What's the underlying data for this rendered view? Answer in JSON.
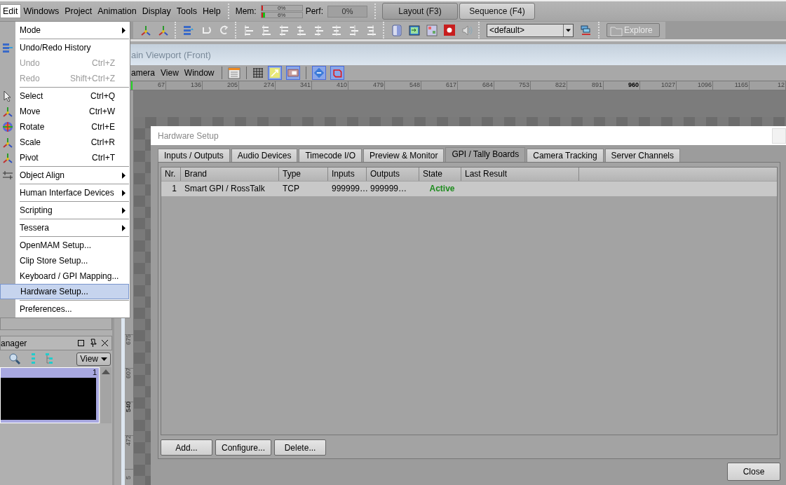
{
  "menubar": {
    "menus": [
      {
        "label": "Edit",
        "selected": true
      },
      {
        "label": "Windows",
        "selected": false
      },
      {
        "label": "Project",
        "selected": false
      },
      {
        "label": "Animation",
        "selected": false
      },
      {
        "label": "Display",
        "selected": false
      },
      {
        "label": "Tools",
        "selected": false
      },
      {
        "label": "Help",
        "selected": false
      }
    ]
  },
  "monitor": {
    "mem_label": "Mem:",
    "mem_meters": [
      {
        "reading": "0%",
        "level": 0
      },
      {
        "reading": "6%",
        "level": 0.06
      }
    ],
    "perf_label": "Perf:",
    "perf_reading": "0%"
  },
  "mode_buttons": [
    {
      "label": "Layout (F3)",
      "selected": true
    },
    {
      "label": "Sequence (F4)",
      "selected": false
    }
  ],
  "toolbar": {
    "preset_dropdown": {
      "value": "<default>"
    },
    "explore_button": {
      "label": "Explore",
      "disabled": true
    }
  },
  "viewport": {
    "title": "ain Viewport (Front)",
    "menus": [
      "amera",
      "View",
      "Window"
    ],
    "ruler_top": [
      {
        "label": "67",
        "selected": false
      },
      {
        "label": "136",
        "selected": false
      },
      {
        "label": "205",
        "selected": false
      },
      {
        "label": "274",
        "selected": false
      },
      {
        "label": "341",
        "selected": false
      },
      {
        "label": "410",
        "selected": false
      },
      {
        "label": "479",
        "selected": false
      },
      {
        "label": "548",
        "selected": false
      },
      {
        "label": "617",
        "selected": false
      },
      {
        "label": "684",
        "selected": false
      },
      {
        "label": "753",
        "selected": false
      },
      {
        "label": "822",
        "selected": false
      },
      {
        "label": "891",
        "selected": false
      },
      {
        "label": "960",
        "selected": true
      },
      {
        "label": "1027",
        "selected": false
      },
      {
        "label": "1096",
        "selected": false
      },
      {
        "label": "1165",
        "selected": false
      },
      {
        "label": "12",
        "selected": false
      }
    ],
    "ruler_left": [
      {
        "label": "675",
        "selected": false
      },
      {
        "label": "607",
        "selected": false
      },
      {
        "label": "540",
        "selected": true
      },
      {
        "label": "472",
        "selected": false
      },
      {
        "label": "5",
        "selected": false
      }
    ]
  },
  "left_panel": {
    "title": "anager",
    "view_button": "View",
    "list_header": "1"
  },
  "edit_menu": {
    "groups": [
      [
        {
          "label": "Mode",
          "submenu": true,
          "disabled": false,
          "selected": false
        }
      ],
      [
        {
          "label": "Undo/Redo History",
          "submenu": false,
          "disabled": false,
          "selected": false
        },
        {
          "label": "Undo",
          "shortcut": "Ctrl+Z",
          "submenu": false,
          "disabled": true,
          "selected": false
        },
        {
          "label": "Redo",
          "shortcut": "Shift+Ctrl+Z",
          "submenu": false,
          "disabled": true,
          "selected": false
        }
      ],
      [
        {
          "label": "Select",
          "shortcut": "Ctrl+Q",
          "submenu": false,
          "disabled": false,
          "selected": false
        },
        {
          "label": "Move",
          "shortcut": "Ctrl+W",
          "submenu": false,
          "disabled": false,
          "selected": false
        },
        {
          "label": "Rotate",
          "shortcut": "Ctrl+E",
          "submenu": false,
          "disabled": false,
          "selected": false
        },
        {
          "label": "Scale",
          "shortcut": "Ctrl+R",
          "submenu": false,
          "disabled": false,
          "selected": false
        },
        {
          "label": "Pivot",
          "shortcut": "Ctrl+T",
          "submenu": false,
          "disabled": false,
          "selected": false
        }
      ],
      [
        {
          "label": "Object Align",
          "submenu": true,
          "disabled": false,
          "selected": false
        }
      ],
      [
        {
          "label": "Human Interface Devices",
          "submenu": true,
          "disabled": false,
          "selected": false
        }
      ],
      [
        {
          "label": "Scripting",
          "submenu": true,
          "disabled": false,
          "selected": false
        }
      ],
      [
        {
          "label": "Tessera",
          "submenu": true,
          "disabled": false,
          "selected": false
        }
      ],
      [
        {
          "label": "OpenMAM Setup...",
          "submenu": false,
          "disabled": false,
          "selected": false
        },
        {
          "label": "Clip Store Setup...",
          "submenu": false,
          "disabled": false,
          "selected": false
        },
        {
          "label": "Keyboard / GPI Mapping...",
          "submenu": false,
          "disabled": false,
          "selected": false
        },
        {
          "label": "Hardware Setup...",
          "submenu": false,
          "disabled": false,
          "selected": true
        }
      ],
      [
        {
          "label": "Preferences...",
          "submenu": false,
          "disabled": false,
          "selected": false
        }
      ]
    ]
  },
  "dialog": {
    "title": "Hardware Setup",
    "tabs": [
      {
        "label": "Inputs / Outputs",
        "selected": false
      },
      {
        "label": "Audio Devices",
        "selected": false
      },
      {
        "label": "Timecode I/O",
        "selected": false
      },
      {
        "label": "Preview & Monitor",
        "selected": false
      },
      {
        "label": "GPI / Tally Boards",
        "selected": true
      },
      {
        "label": "Camera Tracking",
        "selected": false
      },
      {
        "label": "Server Channels",
        "selected": false
      }
    ],
    "table": {
      "columns": [
        "Nr.",
        "Brand",
        "Type",
        "Inputs",
        "Outputs",
        "State",
        "Last Result"
      ],
      "rows": [
        {
          "selected": true,
          "nr": "1",
          "brand": "Smart GPI / RossTalk",
          "type": "TCP",
          "inputs": "999999…",
          "outputs": "999999…",
          "state": {
            "text": "Active",
            "color": "#1e8c1e"
          }
        }
      ]
    },
    "buttons": [
      "Add...",
      "Configure...",
      "Delete..."
    ],
    "close_button": "Close"
  }
}
